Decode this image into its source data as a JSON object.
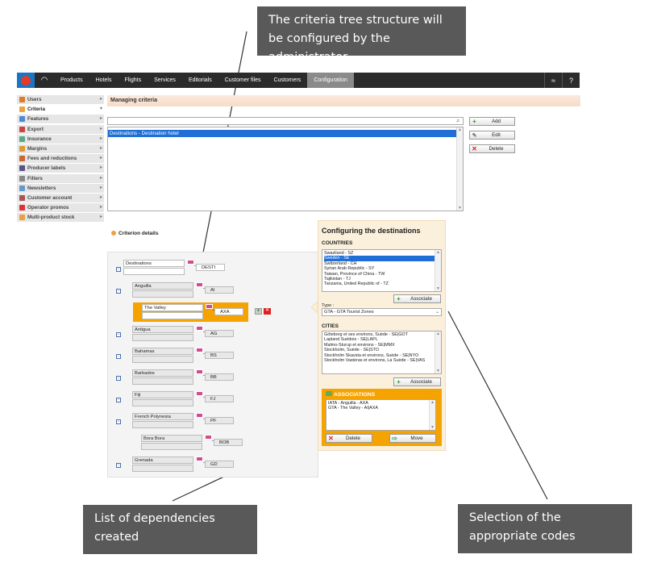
{
  "callouts": {
    "top": "The criteria tree structure will be configured by the administrator",
    "bottom_left": "List of dependencies created",
    "bottom_right": "Selection of the appropriate codes"
  },
  "nav": {
    "tabs": [
      "Products",
      "Hotels",
      "Flights",
      "Services",
      "Editorials",
      "Customer files",
      "Customers",
      "Configuration"
    ],
    "active_tab": "Configuration"
  },
  "sidebar": {
    "items": [
      {
        "label": "Users",
        "icon": "users-icon",
        "color": "#e07b2a"
      },
      {
        "label": "Criteria",
        "icon": "criteria-icon",
        "color": "#f0a040"
      },
      {
        "label": "Features",
        "icon": "features-icon",
        "color": "#4c8ad3"
      },
      {
        "label": "Export",
        "icon": "export-icon",
        "color": "#c44"
      },
      {
        "label": "Insurance",
        "icon": "insurance-icon",
        "color": "#5a8"
      },
      {
        "label": "Margins",
        "icon": "margins-icon",
        "color": "#d93"
      },
      {
        "label": "Fees and reductions",
        "icon": "fees-icon",
        "color": "#c63"
      },
      {
        "label": "Producer labels",
        "icon": "labels-icon",
        "color": "#558"
      },
      {
        "label": "Filters",
        "icon": "filters-icon",
        "color": "#888"
      },
      {
        "label": "Newsletters",
        "icon": "newsletters-icon",
        "color": "#69c"
      },
      {
        "label": "Customer account",
        "icon": "account-icon",
        "color": "#a55"
      },
      {
        "label": "Operator promos",
        "icon": "promos-icon",
        "color": "#d33"
      },
      {
        "label": "Multi-product stock",
        "icon": "stock-icon",
        "color": "#e8a040"
      }
    ],
    "active": "Criteria"
  },
  "managing": {
    "title": "Managing criteria",
    "selected_row": "Destinations - Destination hotel",
    "buttons": {
      "add": "Add",
      "edit": "Edit",
      "delete": "Delete"
    }
  },
  "criterion": {
    "title": "Criterion details",
    "nodes": [
      {
        "name": "Destinations",
        "code": "DESTI"
      },
      {
        "name": "Anguilla",
        "code": "AI"
      },
      {
        "name": "The Valley",
        "code": "AXA"
      },
      {
        "name": "Antigua",
        "code": "AG"
      },
      {
        "name": "Bahamas",
        "code": "BS"
      },
      {
        "name": "Barbados",
        "code": "BB"
      },
      {
        "name": "Fiji",
        "code": "FJ"
      },
      {
        "name": "French Polynesia",
        "code": "PF"
      },
      {
        "name": "Bora Bora",
        "code": "BOB"
      },
      {
        "name": "Grenada",
        "code": "GD"
      }
    ]
  },
  "config": {
    "title": "Configuring the destinations",
    "countries_label": "COUNTRIES",
    "countries": [
      "Swaziland - SZ",
      "Sweden - SE",
      "Switzerland - CH",
      "Syrian Arab Republic - SY",
      "Taiwan, Province of China - TW",
      "Tajikistan - TJ",
      "Tanzania, United Republic of - TZ"
    ],
    "selected_country": "Sweden - SE",
    "associate": "Associate",
    "type_label": "Type :",
    "type_value": "GTA - GTA Tourist Zones",
    "cities_label": "CITIES",
    "cities": [
      "Göteborg et ses environs, Suède - SE|GOT",
      "Lapland Suédois - SE|LAPL",
      "Malmo-Sturup et environs - SE|MMX",
      "Stockholm, Suède - SE|STO",
      "Stockholm Skavsta et environs, Suède - SE|NYO",
      "Stockholm Vasteras et environs, La Suède - SE|VAS"
    ],
    "associations_label": "ASSOCIATIONS",
    "associations": [
      "IATA - Anguilla - AXA",
      "GTA - The Valley - AI|AXA"
    ],
    "delete": "Delete",
    "move": "Move"
  }
}
